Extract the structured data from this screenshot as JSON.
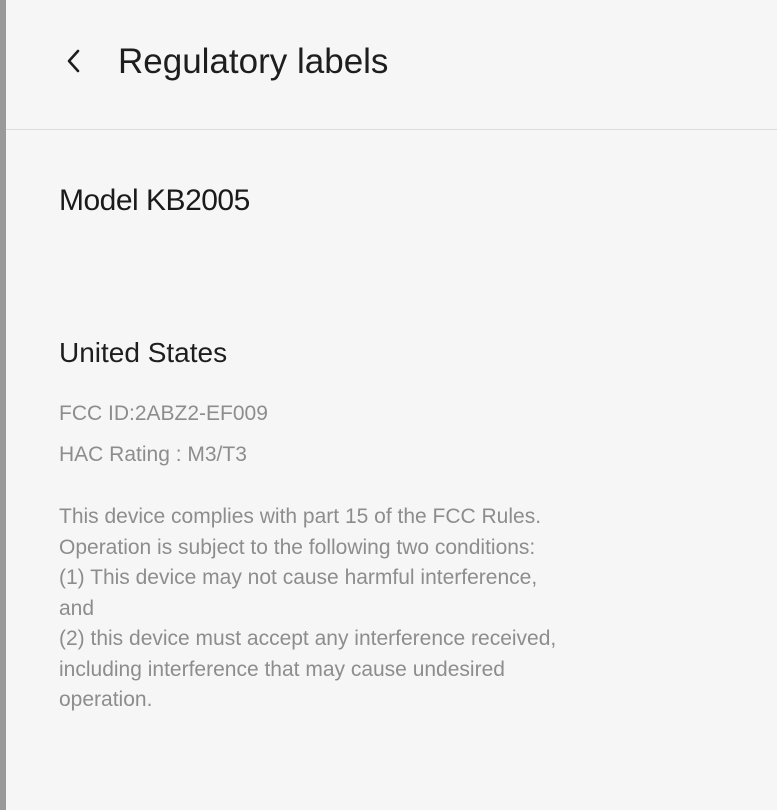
{
  "header": {
    "title": "Regulatory labels",
    "back_icon": "chevron-left-icon"
  },
  "model": {
    "label": "Model KB2005"
  },
  "region": {
    "name": "United States",
    "fcc_id": "FCC ID:2ABZ2-EF009",
    "hac_rating": "HAC Rating : M3/T3",
    "compliance_lines": [
      "This device complies with part 15 of the FCC Rules.",
      "Operation is subject to the following two conditions:",
      "(1) This device may not cause harmful interference,",
      "and",
      "(2) this device must accept any interference received,",
      "including interference that may cause undesired",
      "operation."
    ]
  }
}
